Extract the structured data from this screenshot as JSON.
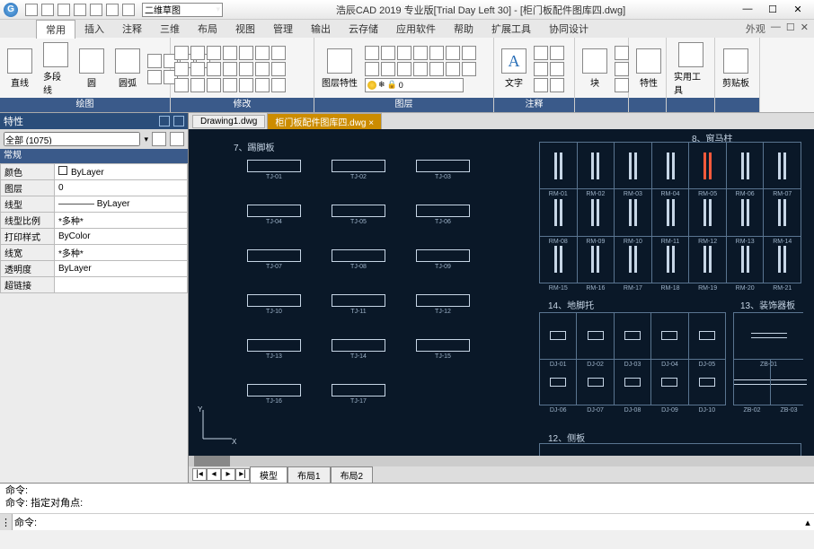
{
  "title": "浩辰CAD 2019 专业版[Trial Day Left 30] - [柜门板配件图库四.dwg]",
  "qat_dropdown": "二维草图",
  "menutabs": {
    "items": [
      "常用",
      "插入",
      "注释",
      "三维",
      "布局",
      "视图",
      "管理",
      "输出",
      "云存储",
      "应用软件",
      "帮助",
      "扩展工具",
      "协同设计"
    ],
    "right_label": "外观",
    "active_index": 0
  },
  "ribbon": {
    "draw": {
      "title": "绘图",
      "btns": [
        "直线",
        "多段线",
        "圆",
        "圆弧"
      ]
    },
    "modify": {
      "title": "修改"
    },
    "layer": {
      "title": "图层",
      "big": "图层特性",
      "combo_value": "0"
    },
    "annotate": {
      "title": "注释",
      "big": "文字"
    },
    "block": {
      "title": "",
      "big": "块"
    },
    "props": {
      "title": "",
      "big": "特性"
    },
    "utils": {
      "title": "",
      "big": "实用工具"
    },
    "clip": {
      "title": "",
      "big": "剪贴板"
    }
  },
  "palette": {
    "title": "特性",
    "selector_value": "全部 (1075)",
    "category": "常规",
    "rows": [
      {
        "k": "颜色",
        "v": "ByLayer",
        "swatch": true
      },
      {
        "k": "图层",
        "v": "0"
      },
      {
        "k": "线型",
        "v": "———— ByLayer"
      },
      {
        "k": "线型比例",
        "v": "*多种*"
      },
      {
        "k": "打印样式",
        "v": "ByColor"
      },
      {
        "k": "线宽",
        "v": "*多种*"
      },
      {
        "k": "透明度",
        "v": "ByLayer"
      },
      {
        "k": "超链接",
        "v": ""
      }
    ]
  },
  "doc_tabs": {
    "items": [
      "Drawing1.dwg",
      "柜门板配件图库四.dwg"
    ],
    "active_index": 1
  },
  "canvas": {
    "sec7": "7、踢脚板",
    "sec8": "8、窗马柱",
    "sec13": "13、装饰器板",
    "sec14": "14、地脚托",
    "sec12": "12、侧板",
    "baseboards": [
      [
        "TJ-01",
        "TJ-02",
        "TJ-03"
      ],
      [
        "TJ-04",
        "TJ-05",
        "TJ-06"
      ],
      [
        "TJ-07",
        "TJ-08",
        "TJ-09"
      ],
      [
        "TJ-10",
        "TJ-11",
        "TJ-12"
      ],
      [
        "TJ-13",
        "TJ-14",
        "TJ-15"
      ],
      [
        "TJ-16",
        "TJ-17",
        ""
      ]
    ],
    "columns_row1": [
      "RM-01",
      "RM-02",
      "RM-03",
      "RM-04",
      "RM-05",
      "RM-06",
      "RM-07"
    ],
    "columns_row2": [
      "RM-08",
      "RM-09",
      "RM-10",
      "RM-11",
      "RM-12",
      "RM-13",
      "RM-14"
    ],
    "columns_row3": [
      "RM-15",
      "RM-16",
      "RM-17",
      "RM-18",
      "RM-19",
      "RM-20",
      "RM-21"
    ],
    "highlight_col_index": 4,
    "feet_row1": [
      "DJ-01",
      "DJ-02",
      "DJ-03",
      "DJ-04",
      "DJ-05"
    ],
    "feet_row2": [
      "DJ-06",
      "DJ-07",
      "DJ-08",
      "DJ-09",
      "DJ-10"
    ],
    "deco_row1": [
      "ZB-01"
    ],
    "deco_row2": [
      "ZB-02",
      "ZB-03"
    ]
  },
  "layout_tabs": {
    "items": [
      "模型",
      "布局1",
      "布局2"
    ],
    "active_index": 0
  },
  "cmd": {
    "h1": "命令:",
    "h2": "命令: 指定对角点:",
    "prompt": "命令:"
  }
}
